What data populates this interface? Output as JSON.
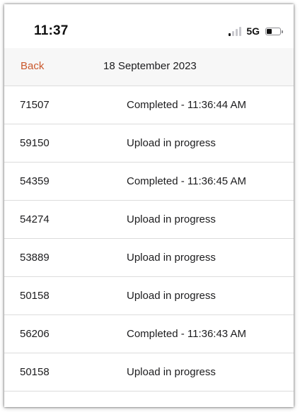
{
  "status_bar": {
    "time": "11:37",
    "network": "5G",
    "signal_bars_active": 1,
    "signal_bars_total": 4,
    "battery_level": 0.4
  },
  "nav": {
    "back_label": "Back",
    "title": "18 September 2023"
  },
  "uploads": [
    {
      "id": "71507",
      "status": "Completed - 11:36:44 AM"
    },
    {
      "id": "59150",
      "status": "Upload in progress"
    },
    {
      "id": "54359",
      "status": "Completed - 11:36:45 AM"
    },
    {
      "id": "54274",
      "status": "Upload in progress"
    },
    {
      "id": "53889",
      "status": "Upload in progress"
    },
    {
      "id": "50158",
      "status": "Upload in progress"
    },
    {
      "id": "56206",
      "status": "Completed - 11:36:43 AM"
    },
    {
      "id": "50158",
      "status": "Upload in progress"
    }
  ],
  "colors": {
    "accent": "#c9582c",
    "signal_active": "#111111",
    "signal_inactive": "#c7c7cc"
  }
}
